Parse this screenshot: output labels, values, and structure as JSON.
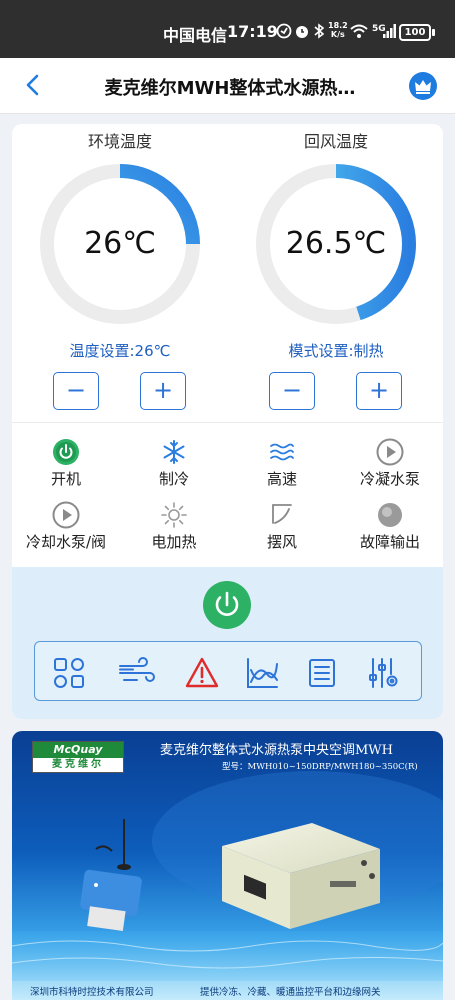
{
  "status_bar": {
    "carrier": "中国电信",
    "time": "17:19",
    "speed_value": "18.2",
    "speed_unit": "K/s",
    "network": "5G",
    "battery": "100"
  },
  "header": {
    "title": "麦克维尔MWH整体式水源热…"
  },
  "gauges": {
    "ambient": {
      "title": "环境温度",
      "value": "26℃",
      "fill": 0.25,
      "setting": "温度设置:26℃"
    },
    "return_air": {
      "title": "回风温度",
      "value": "26.5℃",
      "fill": 0.45,
      "setting": "模式设置:制热"
    }
  },
  "stepper": {
    "minus": "−",
    "plus": "+"
  },
  "status_items": [
    {
      "label": "开机",
      "icon": "power-icon"
    },
    {
      "label": "制冷",
      "icon": "snowflake-icon"
    },
    {
      "label": "高速",
      "icon": "wind-waves-icon"
    },
    {
      "label": "冷凝水泵",
      "icon": "play-circle-icon"
    },
    {
      "label": "冷却水泵/阀",
      "icon": "play-circle-icon"
    },
    {
      "label": "电加热",
      "icon": "sun-icon"
    },
    {
      "label": "摆风",
      "icon": "swing-icon"
    },
    {
      "label": "故障输出",
      "icon": "fault-dot-icon"
    }
  ],
  "menu": [
    {
      "icon": "grid-icon"
    },
    {
      "icon": "wind-icon"
    },
    {
      "icon": "alarm-triangle-icon"
    },
    {
      "icon": "chart-icon"
    },
    {
      "icon": "list-icon"
    },
    {
      "icon": "settings-sliders-icon"
    }
  ],
  "banner": {
    "logo_en": "McQuay",
    "logo_cn": "麦克维尔",
    "title": "麦克维尔整体式水源热泵中央空调MWH",
    "model": "型号：MWH010~150DRP/MWH180~350C(R)",
    "footer_left": "深圳市科特时控技术有限公司",
    "footer_right": "提供冷冻、冷藏、暖通监控平台和边缘网关"
  },
  "colors": {
    "accent_blue": "#1e7be0",
    "power_green": "#2db165",
    "alarm_red": "#e02b2b",
    "panel_bg": "#ddeefa"
  }
}
